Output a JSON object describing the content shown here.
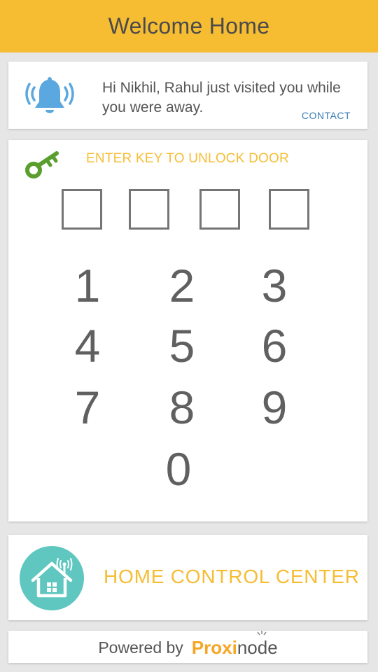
{
  "header": {
    "title": "Welcome Home"
  },
  "notification": {
    "message": "Hi Nikhil, Rahul just visited you while you were away.",
    "action_label": "CONTACT",
    "icon": "bell-icon"
  },
  "unlock": {
    "prompt": "ENTER KEY TO UNLOCK DOOR",
    "icon": "key-icon",
    "pin_length": 4,
    "keys": [
      "1",
      "2",
      "3",
      "4",
      "5",
      "6",
      "7",
      "8",
      "9",
      "0"
    ]
  },
  "home_control": {
    "label": "HOME CONTROL CENTER",
    "icon": "house-icon"
  },
  "footer": {
    "powered_by": "Powered by",
    "brand_part1": "Proxi",
    "brand_part2": "node"
  },
  "colors": {
    "accent": "#f6bd33",
    "key_green": "#5a9e2e",
    "bell_blue": "#5ba7e0",
    "house_teal": "#5fc7c0",
    "link_blue": "#3b7fb8"
  }
}
